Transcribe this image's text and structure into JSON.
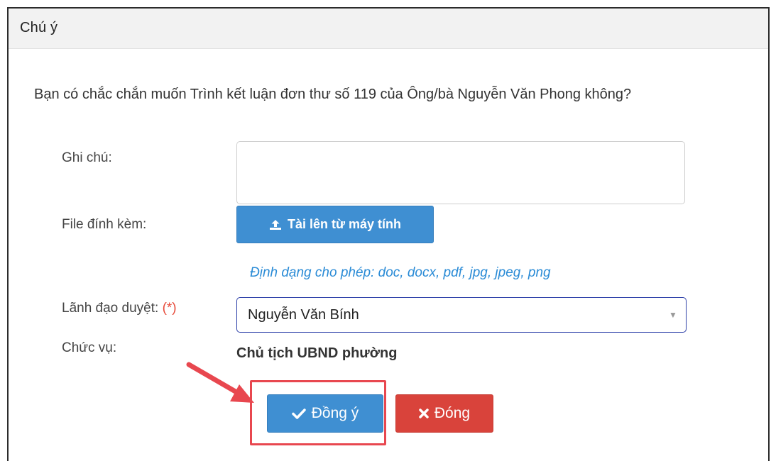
{
  "dialog": {
    "title": "Chú ý",
    "question": "Bạn có chắc chắn muốn Trình kết luận đơn thư số 119 của Ông/bà Nguyễn Văn Phong không?"
  },
  "form": {
    "note_label": "Ghi chú:",
    "note_value": "",
    "attachment_label": "File đính kèm:",
    "upload_button": "Tài lên từ máy tính",
    "allowed_formats": "Định dạng cho phép: doc, docx, pdf, jpg, jpeg, png",
    "approver_label": "Lãnh đạo duyệt:",
    "required_mark": "(*)",
    "approver_value": "Nguyễn Văn Bính",
    "position_label": "Chức vụ:",
    "position_value": "Chủ tịch UBND phường"
  },
  "actions": {
    "confirm": "Đồng ý",
    "close": "Đóng"
  },
  "icons": {
    "upload": "upload-icon",
    "confirm": "check-icon",
    "close": "x-icon",
    "dropdown": "caret-down-icon"
  },
  "colors": {
    "primary": "#3f8fd2",
    "danger": "#d9433b",
    "highlight": "#e8474f",
    "link": "#2a8bd6"
  }
}
